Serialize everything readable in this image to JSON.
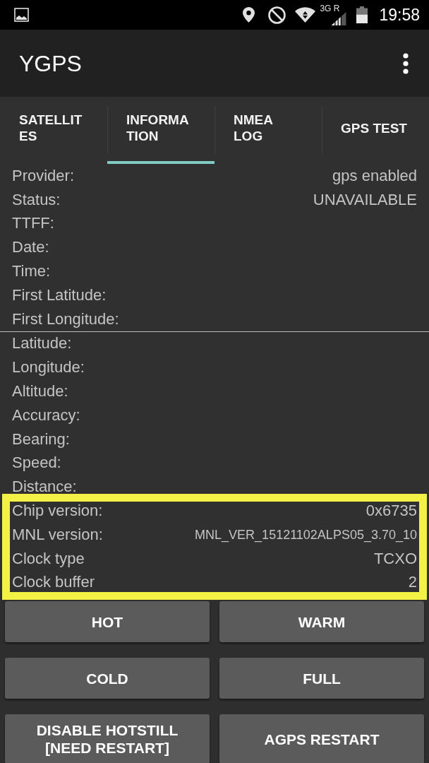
{
  "status_bar": {
    "network_label": "3G R",
    "time": "19:58"
  },
  "app_bar": {
    "title": "YGPS"
  },
  "tabs": [
    {
      "label": "SATELLITES",
      "selected": false
    },
    {
      "label": "INFORMATION",
      "selected": true
    },
    {
      "label": "NMEA LOG",
      "selected": false
    },
    {
      "label": "GPS TEST",
      "selected": false
    }
  ],
  "info": {
    "sections": [
      {
        "highlighted": false,
        "rows": [
          {
            "label": "Provider:",
            "value": "gps enabled"
          },
          {
            "label": "Status:",
            "value": "UNAVAILABLE"
          },
          {
            "label": "TTFF:"
          },
          {
            "label": "Date:"
          },
          {
            "label": "Time:"
          },
          {
            "label": "First Latitude:"
          },
          {
            "label": "First Longitude:"
          }
        ]
      },
      {
        "highlighted": false,
        "rows": [
          {
            "label": "Latitude:"
          },
          {
            "label": "Longitude:"
          },
          {
            "label": "Altitude:"
          },
          {
            "label": "Accuracy:"
          },
          {
            "label": "Bearing:"
          },
          {
            "label": "Speed:"
          },
          {
            "label": "Distance:"
          }
        ]
      },
      {
        "highlighted": true,
        "rows": [
          {
            "label": "Chip version:",
            "value": "0x6735"
          },
          {
            "label": "MNL version:",
            "value": "MNL_VER_15121102ALPS05_3.70_10"
          },
          {
            "label": "Clock type",
            "value": "TCXO"
          },
          {
            "label": "Clock buffer",
            "value": "2"
          }
        ]
      }
    ]
  },
  "buttons": [
    {
      "label": "HOT"
    },
    {
      "label": "WARM"
    },
    {
      "label": "COLD"
    },
    {
      "label": "FULL"
    },
    {
      "label": "DISABLE HOTSTILL [NEED RESTART]"
    },
    {
      "label": "AGPS RESTART"
    }
  ]
}
